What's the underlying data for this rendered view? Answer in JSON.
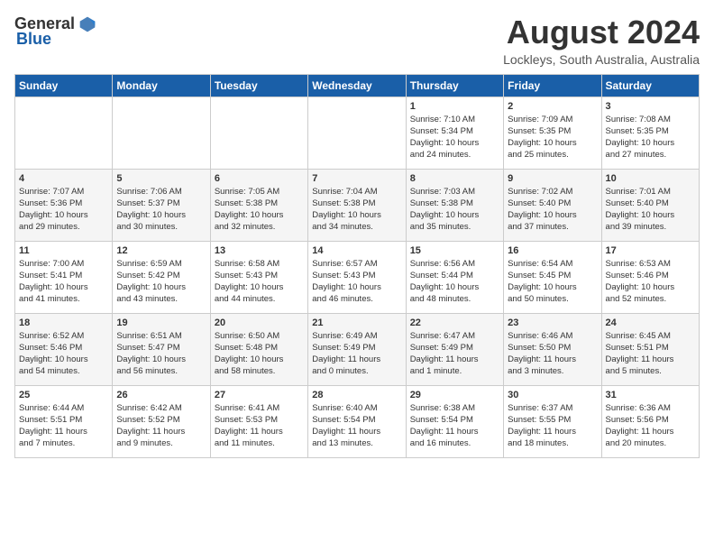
{
  "header": {
    "logo_general": "General",
    "logo_blue": "Blue",
    "month_year": "August 2024",
    "location": "Lockleys, South Australia, Australia"
  },
  "columns": [
    "Sunday",
    "Monday",
    "Tuesday",
    "Wednesday",
    "Thursday",
    "Friday",
    "Saturday"
  ],
  "weeks": [
    [
      {
        "day": "",
        "info": ""
      },
      {
        "day": "",
        "info": ""
      },
      {
        "day": "",
        "info": ""
      },
      {
        "day": "",
        "info": ""
      },
      {
        "day": "1",
        "info": "Sunrise: 7:10 AM\nSunset: 5:34 PM\nDaylight: 10 hours\nand 24 minutes."
      },
      {
        "day": "2",
        "info": "Sunrise: 7:09 AM\nSunset: 5:35 PM\nDaylight: 10 hours\nand 25 minutes."
      },
      {
        "day": "3",
        "info": "Sunrise: 7:08 AM\nSunset: 5:35 PM\nDaylight: 10 hours\nand 27 minutes."
      }
    ],
    [
      {
        "day": "4",
        "info": "Sunrise: 7:07 AM\nSunset: 5:36 PM\nDaylight: 10 hours\nand 29 minutes."
      },
      {
        "day": "5",
        "info": "Sunrise: 7:06 AM\nSunset: 5:37 PM\nDaylight: 10 hours\nand 30 minutes."
      },
      {
        "day": "6",
        "info": "Sunrise: 7:05 AM\nSunset: 5:38 PM\nDaylight: 10 hours\nand 32 minutes."
      },
      {
        "day": "7",
        "info": "Sunrise: 7:04 AM\nSunset: 5:38 PM\nDaylight: 10 hours\nand 34 minutes."
      },
      {
        "day": "8",
        "info": "Sunrise: 7:03 AM\nSunset: 5:38 PM\nDaylight: 10 hours\nand 35 minutes."
      },
      {
        "day": "9",
        "info": "Sunrise: 7:02 AM\nSunset: 5:40 PM\nDaylight: 10 hours\nand 37 minutes."
      },
      {
        "day": "10",
        "info": "Sunrise: 7:01 AM\nSunset: 5:40 PM\nDaylight: 10 hours\nand 39 minutes."
      }
    ],
    [
      {
        "day": "11",
        "info": "Sunrise: 7:00 AM\nSunset: 5:41 PM\nDaylight: 10 hours\nand 41 minutes."
      },
      {
        "day": "12",
        "info": "Sunrise: 6:59 AM\nSunset: 5:42 PM\nDaylight: 10 hours\nand 43 minutes."
      },
      {
        "day": "13",
        "info": "Sunrise: 6:58 AM\nSunset: 5:43 PM\nDaylight: 10 hours\nand 44 minutes."
      },
      {
        "day": "14",
        "info": "Sunrise: 6:57 AM\nSunset: 5:43 PM\nDaylight: 10 hours\nand 46 minutes."
      },
      {
        "day": "15",
        "info": "Sunrise: 6:56 AM\nSunset: 5:44 PM\nDaylight: 10 hours\nand 48 minutes."
      },
      {
        "day": "16",
        "info": "Sunrise: 6:54 AM\nSunset: 5:45 PM\nDaylight: 10 hours\nand 50 minutes."
      },
      {
        "day": "17",
        "info": "Sunrise: 6:53 AM\nSunset: 5:46 PM\nDaylight: 10 hours\nand 52 minutes."
      }
    ],
    [
      {
        "day": "18",
        "info": "Sunrise: 6:52 AM\nSunset: 5:46 PM\nDaylight: 10 hours\nand 54 minutes."
      },
      {
        "day": "19",
        "info": "Sunrise: 6:51 AM\nSunset: 5:47 PM\nDaylight: 10 hours\nand 56 minutes."
      },
      {
        "day": "20",
        "info": "Sunrise: 6:50 AM\nSunset: 5:48 PM\nDaylight: 10 hours\nand 58 minutes."
      },
      {
        "day": "21",
        "info": "Sunrise: 6:49 AM\nSunset: 5:49 PM\nDaylight: 11 hours\nand 0 minutes."
      },
      {
        "day": "22",
        "info": "Sunrise: 6:47 AM\nSunset: 5:49 PM\nDaylight: 11 hours\nand 1 minute."
      },
      {
        "day": "23",
        "info": "Sunrise: 6:46 AM\nSunset: 5:50 PM\nDaylight: 11 hours\nand 3 minutes."
      },
      {
        "day": "24",
        "info": "Sunrise: 6:45 AM\nSunset: 5:51 PM\nDaylight: 11 hours\nand 5 minutes."
      }
    ],
    [
      {
        "day": "25",
        "info": "Sunrise: 6:44 AM\nSunset: 5:51 PM\nDaylight: 11 hours\nand 7 minutes."
      },
      {
        "day": "26",
        "info": "Sunrise: 6:42 AM\nSunset: 5:52 PM\nDaylight: 11 hours\nand 9 minutes."
      },
      {
        "day": "27",
        "info": "Sunrise: 6:41 AM\nSunset: 5:53 PM\nDaylight: 11 hours\nand 11 minutes."
      },
      {
        "day": "28",
        "info": "Sunrise: 6:40 AM\nSunset: 5:54 PM\nDaylight: 11 hours\nand 13 minutes."
      },
      {
        "day": "29",
        "info": "Sunrise: 6:38 AM\nSunset: 5:54 PM\nDaylight: 11 hours\nand 16 minutes."
      },
      {
        "day": "30",
        "info": "Sunrise: 6:37 AM\nSunset: 5:55 PM\nDaylight: 11 hours\nand 18 minutes."
      },
      {
        "day": "31",
        "info": "Sunrise: 6:36 AM\nSunset: 5:56 PM\nDaylight: 11 hours\nand 20 minutes."
      }
    ]
  ]
}
